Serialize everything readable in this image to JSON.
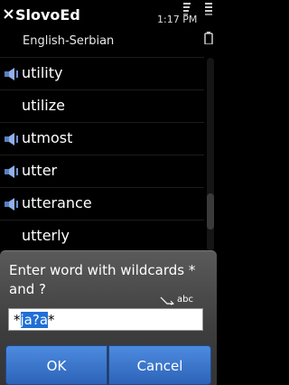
{
  "app": {
    "title": "SlovoEd",
    "dictionary": "English-Serbian",
    "clock": "1:17 PM"
  },
  "icons": {
    "close": "close-icon",
    "signal": "signal-icon",
    "battery": "battery-icon",
    "speaker": "speaker-icon",
    "input_mode": "pen-icon"
  },
  "words": [
    {
      "text": "utility",
      "audio": true
    },
    {
      "text": "utilize",
      "audio": false
    },
    {
      "text": "utmost",
      "audio": true
    },
    {
      "text": "utter",
      "audio": true
    },
    {
      "text": "utterance",
      "audio": true
    },
    {
      "text": "utterly",
      "audio": false
    }
  ],
  "dialog": {
    "prompt": "Enter word with wildcards * and ?",
    "input_mode": "abc",
    "input_prefix": "*",
    "input_selected": "ja?a",
    "input_suffix": "*",
    "ok_label": "OK",
    "cancel_label": "Cancel"
  },
  "colors": {
    "accent": "#2c63b8",
    "selection": "#1f6fd6"
  }
}
